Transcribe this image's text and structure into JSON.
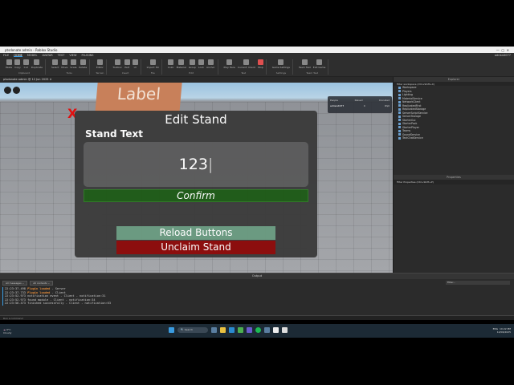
{
  "window": {
    "title": "ptsdonate admin - Roblox Studio",
    "controls": [
      "—",
      "▢",
      "✕"
    ]
  },
  "menu": {
    "tabs": [
      "FILE",
      "HOME",
      "MODEL",
      "AVATAR",
      "TEST",
      "VIEW",
      "PLUGINS"
    ],
    "active": "HOME",
    "user": "adrianX077"
  },
  "ribbon": {
    "groups": [
      {
        "label": "Clipboard",
        "tools": [
          "Paste",
          "Copy",
          "Cut",
          "Duplicate"
        ]
      },
      {
        "label": "Tools",
        "tools": [
          "Select",
          "Move",
          "Scale",
          "Rotate"
        ]
      },
      {
        "label": "Terrain",
        "tools": [
          "Editor"
        ]
      },
      {
        "label": "Insert",
        "tools": [
          "Toolbox",
          "Part",
          "UI"
        ]
      },
      {
        "label": "File",
        "tools": [
          "Import 3D"
        ]
      },
      {
        "label": "Edit",
        "tools": [
          "Color",
          "Material",
          "Group",
          "Lock",
          "Anchor"
        ]
      },
      {
        "label": "Test",
        "tools": [
          "Play Here",
          "Current: Client",
          "Stop"
        ]
      },
      {
        "label": "Settings",
        "tools": [
          "Game Settings"
        ]
      },
      {
        "label": "Team Test",
        "tools": [
          "Team Test",
          "Exit Game"
        ]
      }
    ]
  },
  "document_tab": "ptsdonate admin @ 12 Jun 2025 ✕",
  "viewport": {
    "part_label": "Label",
    "x_mark": "X",
    "leaderboard": {
      "headers": [
        "People",
        "Raised",
        "Donated"
      ],
      "rows": [
        [
          "adrianX077",
          "0",
          "R$0"
        ]
      ]
    }
  },
  "dialog": {
    "title": "Edit Stand",
    "field_label": "Stand Text",
    "input_value": "123",
    "confirm": "Confirm",
    "reload": "Reload Buttons",
    "unclaim": "Unclaim Stand"
  },
  "explorer": {
    "title": "Explorer",
    "filter": "Filter workspace (Ctrl+Shift+X)",
    "items": [
      "Workspace",
      "Players",
      "Lighting",
      "MaterialService",
      "NetworkClient",
      "ReplicatedFirst",
      "ReplicatedStorage",
      "ServerScriptService",
      "ServerStorage",
      "StarterGui",
      "StarterPack",
      "StarterPlayer",
      "Teams",
      "SoundService",
      "TextChatService"
    ]
  },
  "properties": {
    "title": "Properties",
    "filter": "Filter Properties (Ctrl+Shift+P)"
  },
  "output": {
    "title": "Output",
    "filters": [
      "All messages ⌄",
      "All contexts ⌄"
    ],
    "search": "Filter...",
    "lines": [
      {
        "time": "22:23:37.498",
        "msg": "Plugin loaded",
        "ctx": " - Server",
        "warn": true
      },
      {
        "time": "22:23:37.733",
        "msg": "Plugin loaded",
        "ctx": " - Client",
        "warn": true
      },
      {
        "time": "22:23:52.973",
        "msg": "notification event",
        "ctx": " - Client - notification:31",
        "warn": false
      },
      {
        "time": "22:23:52.973",
        "msg": "found module",
        "ctx": " - Client - notification:34",
        "warn": false
      },
      {
        "time": "22:23:56.473",
        "msg": "finished successfully",
        "ctx": " - Client - notification:63",
        "warn": false
      }
    ]
  },
  "command_bar": "Run a command",
  "taskbar": {
    "weather_temp": "9°C",
    "weather_desc": "Cloudy",
    "search": "Search",
    "lang": "ENG",
    "time": "10:22 PM",
    "date": "12/06/2025"
  }
}
